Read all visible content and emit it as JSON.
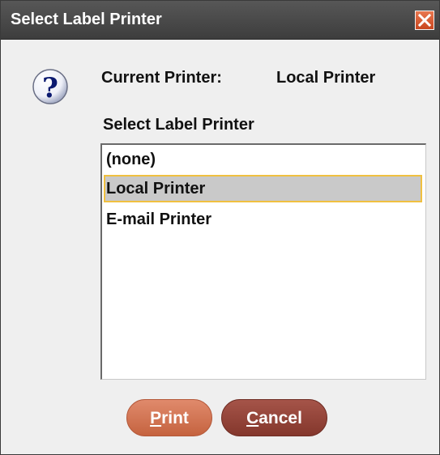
{
  "dialog": {
    "title": "Select Label Printer",
    "close_icon": "close-icon",
    "help_icon": "question-mark-icon"
  },
  "current_printer": {
    "label": "Current Printer:",
    "value": "Local Printer"
  },
  "printer_list": {
    "heading": "Select Label Printer",
    "items": [
      {
        "label": "(none)",
        "selected": false
      },
      {
        "label": "Local Printer",
        "selected": true
      },
      {
        "label": "E-mail Printer",
        "selected": false
      }
    ]
  },
  "buttons": {
    "print": {
      "mnemonic": "P",
      "rest": "rint"
    },
    "cancel": {
      "mnemonic": "C",
      "rest": "ancel"
    }
  },
  "colors": {
    "titlebar": "#4a4a4a",
    "close_button": "#d9582f",
    "print_button": "#d2734f",
    "cancel_button": "#954538",
    "selection_border": "#f0c040",
    "selection_fill": "#c9c9c9"
  }
}
